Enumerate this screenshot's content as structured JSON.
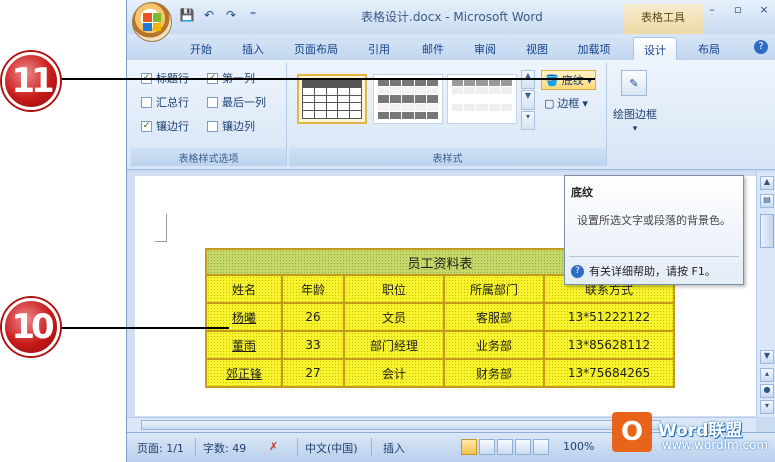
{
  "window": {
    "doc_title": "表格设计.docx - Microsoft Word",
    "context_tab_title": "表格工具",
    "controls": {
      "minimize": "–",
      "restore": "▫",
      "close": "×"
    }
  },
  "qat": {
    "save": "💾",
    "undo": "↶",
    "redo": "↷",
    "more": "⁼"
  },
  "tabs": [
    {
      "label": "开始"
    },
    {
      "label": "插入"
    },
    {
      "label": "页面布局"
    },
    {
      "label": "引用"
    },
    {
      "label": "邮件"
    },
    {
      "label": "审阅"
    },
    {
      "label": "视图"
    },
    {
      "label": "加载项"
    },
    {
      "label": "设计"
    },
    {
      "label": "布局"
    }
  ],
  "ribbon": {
    "style_options": {
      "label": "表格样式选项",
      "items": [
        {
          "label": "标题行",
          "checked": true
        },
        {
          "label": "第一列",
          "checked": true
        },
        {
          "label": "汇总行",
          "checked": false
        },
        {
          "label": "最后一列",
          "checked": false
        },
        {
          "label": "镶边行",
          "checked": true
        },
        {
          "label": "镶边列",
          "checked": false
        }
      ]
    },
    "table_styles": {
      "label": "表样式",
      "shading_label": "底纹",
      "border_label": "边框"
    },
    "draw_borders": {
      "label": "绘图边框"
    }
  },
  "tooltip": {
    "title": "底纹",
    "body": "设置所选文字或段落的背景色。",
    "help": "有关详细帮助，请按 F1。"
  },
  "table": {
    "caption": "员工资料表",
    "headers": [
      "姓名",
      "年龄",
      "职位",
      "所属部门",
      "联系方式"
    ],
    "rows": [
      [
        "杨曦",
        "26",
        "文员",
        "客服部",
        "13*51222122"
      ],
      [
        "董雨",
        "33",
        "部门经理",
        "业务部",
        "13*85628112"
      ],
      [
        "郊正锋",
        "27",
        "会计",
        "财务部",
        "13*75684265"
      ]
    ]
  },
  "status": {
    "page": "页面: 1/1",
    "words": "字数: 49",
    "language": "中文(中国)",
    "mode": "插入",
    "zoom": "100%"
  },
  "callouts": {
    "top": "11",
    "bottom": "10"
  },
  "watermark": {
    "line1": "Word联盟",
    "line2": "www.wordlm.com"
  }
}
